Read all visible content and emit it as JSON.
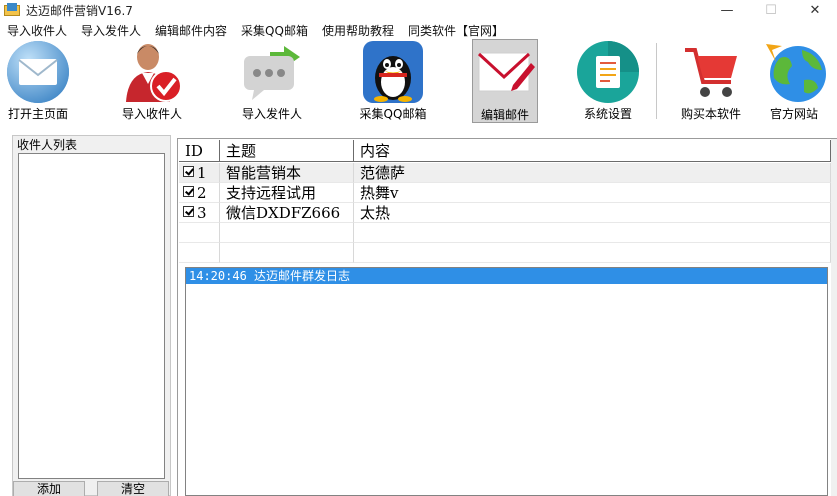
{
  "window": {
    "title": "达迈邮件营销V16.7",
    "minimize": "—",
    "maximize": "☐",
    "close": "✕"
  },
  "menu": [
    "导入收件人",
    "导入发件人",
    "编辑邮件内容",
    "采集QQ邮箱",
    "使用帮助教程",
    "同类软件【官网】"
  ],
  "toolbar": [
    {
      "label": "打开主页面",
      "icon": "envelope-icon"
    },
    {
      "label": "导入收件人",
      "icon": "user-check-icon"
    },
    {
      "label": "导入发件人",
      "icon": "chat-forward-icon"
    },
    {
      "label": "采集QQ邮箱",
      "icon": "qq-penguin-icon"
    },
    {
      "label": "编辑邮件",
      "icon": "edit-mail-icon",
      "active": true
    },
    {
      "label": "系统设置",
      "icon": "settings-list-icon"
    },
    {
      "label": "购买本软件",
      "icon": "shopping-cart-icon"
    },
    {
      "label": "官方网站",
      "icon": "globe-icon"
    }
  ],
  "recipients": {
    "title": "收件人列表",
    "add_label": "添加",
    "clear_label": "清空"
  },
  "grid": {
    "columns": [
      "ID",
      "主题",
      "内容"
    ],
    "rows": [
      {
        "id": "1",
        "subject": "智能营销本",
        "content": "范德萨",
        "checked": true
      },
      {
        "id": "2",
        "subject": "支持远程试用",
        "content": "热舞v",
        "checked": true
      },
      {
        "id": "3",
        "subject": "微信DXDFZ666",
        "content": "太热",
        "checked": true
      }
    ]
  },
  "log": {
    "lines": [
      "14:20:46 达迈邮件群发日志"
    ]
  },
  "colors": {
    "accent_blue": "#2f8fe6",
    "active_toolbar_bg": "#d5d5d5"
  }
}
